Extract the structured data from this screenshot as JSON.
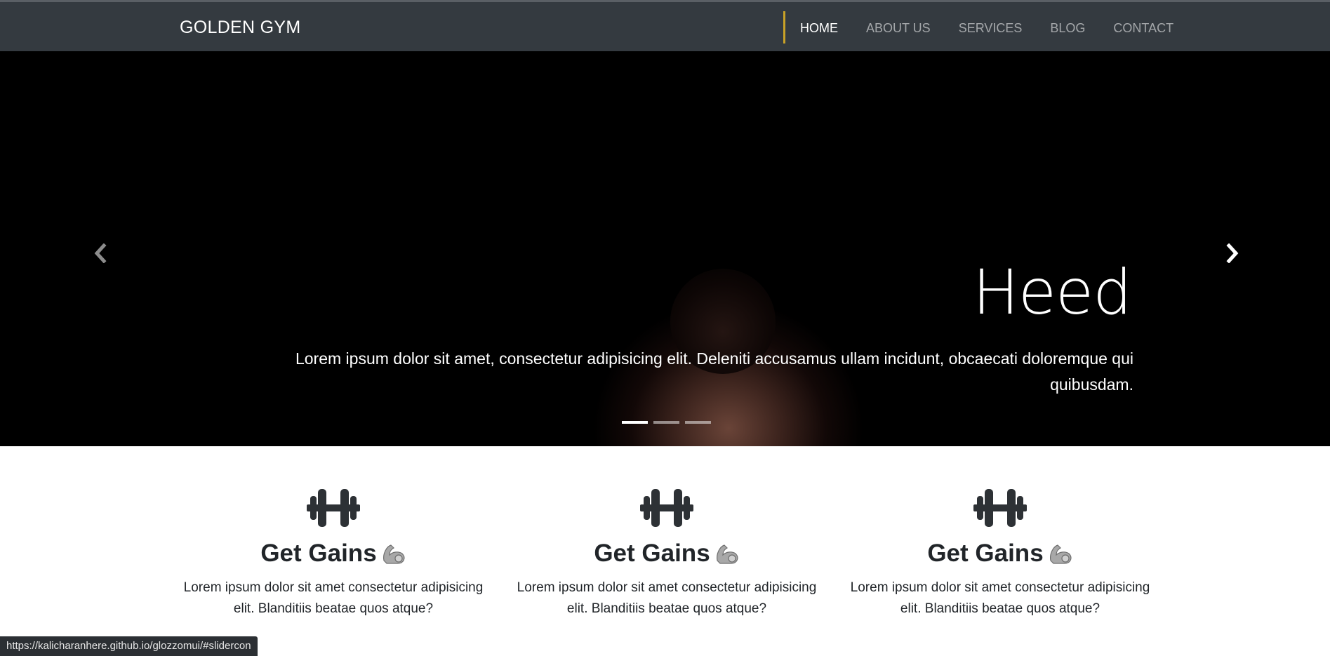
{
  "navbar": {
    "brand": "GOLDEN GYM",
    "links": [
      "HOME",
      "ABOUT US",
      "SERVICES",
      "BLOG",
      "CONTACT"
    ],
    "accent_color": "#c9a227"
  },
  "hero": {
    "title": "Heed",
    "text": "Lorem ipsum dolor sit amet, consectetur adipisicing elit. Deleniti accusamus ullam incidunt, obcaecati doloremque qui quibusdam.",
    "prev_icon": "chevron-left-icon",
    "next_icon": "chevron-right-icon",
    "slides_count": 3,
    "active_slide": 1
  },
  "features": [
    {
      "icon": "dumbbell-icon",
      "title": "Get Gains",
      "emoji": "flexed-biceps-icon",
      "text": "Lorem ipsum dolor sit amet consectetur adipisicing elit. Blanditiis beatae quos atque?"
    },
    {
      "icon": "dumbbell-icon",
      "title": "Get Gains",
      "emoji": "flexed-biceps-icon",
      "text": "Lorem ipsum dolor sit amet consectetur adipisicing elit. Blanditiis beatae quos atque?"
    },
    {
      "icon": "dumbbell-icon",
      "title": "Get Gains",
      "emoji": "flexed-biceps-icon",
      "text": "Lorem ipsum dolor sit amet consectetur adipisicing elit. Blanditiis beatae quos atque?"
    }
  ],
  "statusbar": {
    "url": "https://kalicharanhere.github.io/glozzomui/#slidercon"
  }
}
